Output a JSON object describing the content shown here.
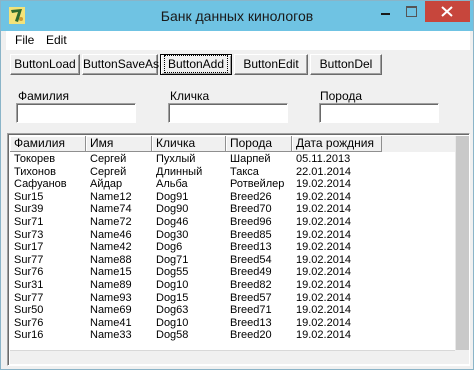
{
  "window": {
    "title": "Банк данных кинологов",
    "icon": "app-logo-icon",
    "controls": [
      "minimize-icon",
      "maximize-icon",
      "close-icon"
    ],
    "close_color": "#c7463c",
    "titlebar_color": "#6fc3e3"
  },
  "menu": {
    "file": "File",
    "edit": "Edit"
  },
  "toolbar": {
    "load": "ButtonLoad",
    "save_as": "ButtonSaveAs",
    "add": "ButtonAdd",
    "edit": "ButtonEdit",
    "delete": "ButtonDel"
  },
  "filters": {
    "surname_label": "Фамилия",
    "nickname_label": "Кличка",
    "breed_label": "Порода",
    "surname_value": "",
    "nickname_value": "",
    "breed_value": ""
  },
  "grid": {
    "columns": [
      "Фамилия",
      "Имя",
      "Кличка",
      "Порода",
      "Дата рождния"
    ],
    "rows": [
      [
        "Токорев",
        "Сергей",
        "Пухлый",
        "Шарпей",
        "05.11.2013"
      ],
      [
        "Тихонов",
        "Сергей",
        "Длинный",
        "Такса",
        "22.01.2014"
      ],
      [
        "Сафуанов",
        "Айдар",
        "Альба",
        "Ротвейлер",
        "19.02.2014"
      ],
      [
        "Sur15",
        "Name12",
        "Dog91",
        "Breed26",
        "19.02.2014"
      ],
      [
        "Sur39",
        "Name74",
        "Dog90",
        "Breed70",
        "19.02.2014"
      ],
      [
        "Sur71",
        "Name72",
        "Dog46",
        "Breed96",
        "19.02.2014"
      ],
      [
        "Sur73",
        "Name46",
        "Dog30",
        "Breed85",
        "19.02.2014"
      ],
      [
        "Sur17",
        "Name42",
        "Dog6",
        "Breed13",
        "19.02.2014"
      ],
      [
        "Sur77",
        "Name88",
        "Dog71",
        "Breed54",
        "19.02.2014"
      ],
      [
        "Sur76",
        "Name15",
        "Dog55",
        "Breed49",
        "19.02.2014"
      ],
      [
        "Sur31",
        "Name89",
        "Dog10",
        "Breed82",
        "19.02.2014"
      ],
      [
        "Sur77",
        "Name93",
        "Dog15",
        "Breed57",
        "19.02.2014"
      ],
      [
        "Sur50",
        "Name69",
        "Dog63",
        "Breed71",
        "19.02.2014"
      ],
      [
        "Sur76",
        "Name41",
        "Dog10",
        "Breed13",
        "19.02.2014"
      ],
      [
        "Sur16",
        "Name33",
        "Dog58",
        "Breed20",
        "19.02.2014"
      ]
    ]
  }
}
